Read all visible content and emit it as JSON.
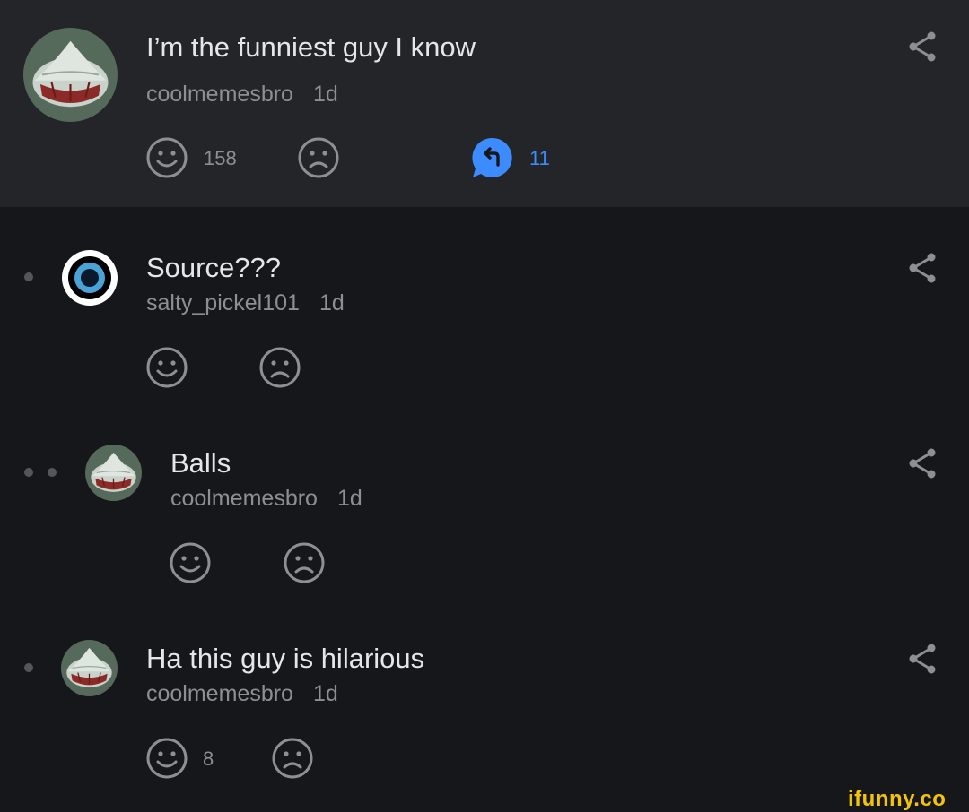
{
  "post": {
    "title": "I’m the funniest guy I know",
    "author": "coolmemesbro",
    "time": "1d",
    "smile_count": "158",
    "reply_count": "11"
  },
  "comments": [
    {
      "text": "Source???",
      "author": "salty_pickel101",
      "time": "1d",
      "smile_count": ""
    },
    {
      "text": "Balls",
      "author": "coolmemesbro",
      "time": "1d",
      "smile_count": ""
    },
    {
      "text": "Ha this guy is hilarious",
      "author": "coolmemesbro",
      "time": "1d",
      "smile_count": "8"
    }
  ],
  "watermark": "ifunny.co",
  "colors": {
    "background": "#16171b",
    "post_header_bg": "#242529",
    "text_primary": "#e6e6e8",
    "text_secondary": "#8e8f94",
    "accent_blue": "#3d8cff",
    "watermark_yellow": "#f4c40c"
  },
  "icons": {
    "smile": "smile-icon",
    "frown": "frown-icon",
    "reply": "reply-bubble-icon",
    "share": "share-icon"
  }
}
